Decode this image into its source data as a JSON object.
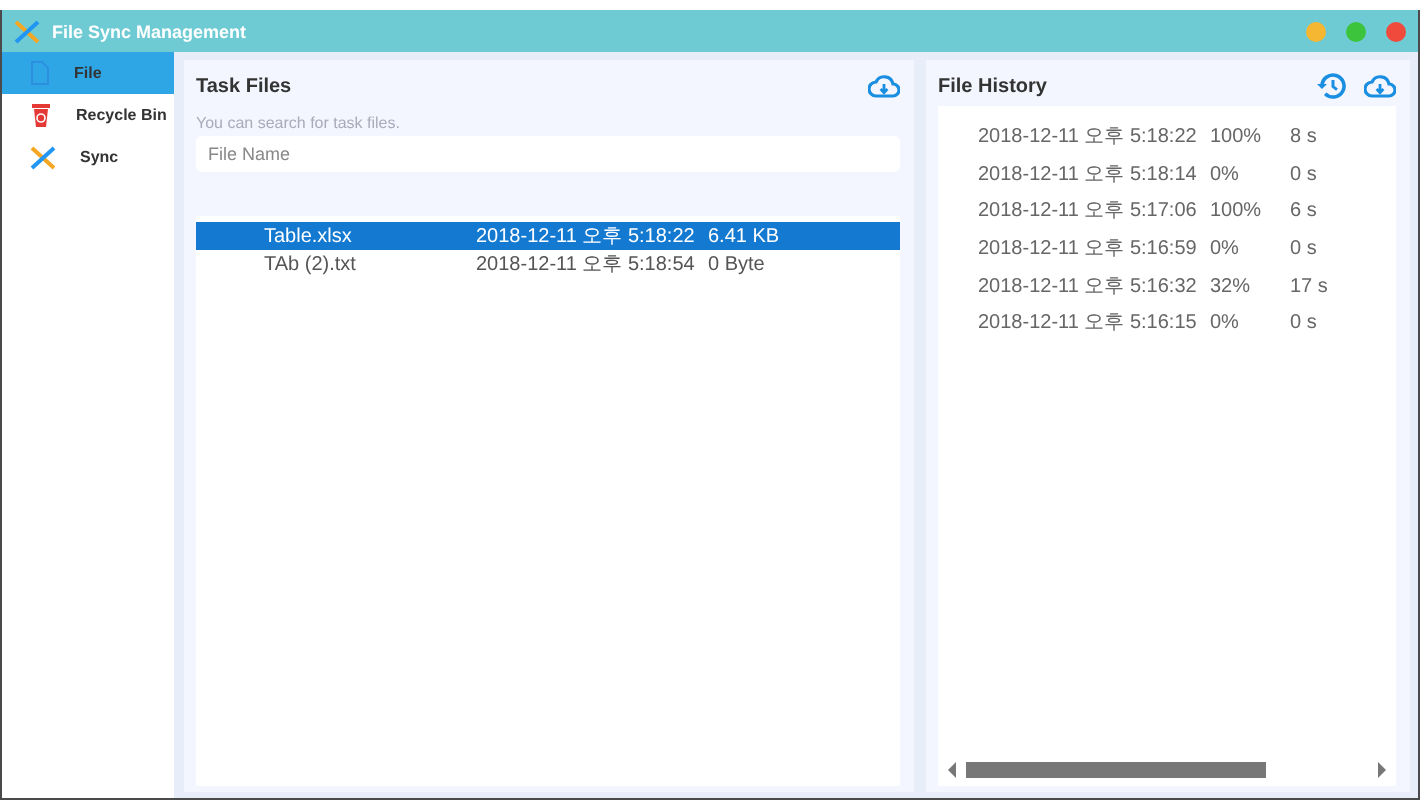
{
  "window": {
    "title": "File Sync Management"
  },
  "sidebar": {
    "items": [
      {
        "label": "File",
        "kind": "file",
        "selected": true
      },
      {
        "label": "Recycle Bin",
        "kind": "bin",
        "selected": false
      },
      {
        "label": "Sync",
        "kind": "sync",
        "selected": false
      }
    ]
  },
  "task_files": {
    "title": "Task Files",
    "hint": "You can search for task files.",
    "search": {
      "placeholder": "File Name"
    },
    "rows": [
      {
        "name": "Table.xlsx",
        "modified": "2018-12-11 오후 5:18:22",
        "size": "6.41 KB",
        "selected": true
      },
      {
        "name": "TAb (2).txt",
        "modified": "2018-12-11 오후 5:18:54",
        "size": "0 Byte",
        "selected": false
      }
    ]
  },
  "file_history": {
    "title": "File History",
    "rows": [
      {
        "time": "2018-12-11 오후 5:18:22",
        "progress": "100%",
        "duration": "8 s"
      },
      {
        "time": "2018-12-11 오후 5:18:14",
        "progress": "0%",
        "duration": "0 s"
      },
      {
        "time": "2018-12-11 오후 5:17:06",
        "progress": "100%",
        "duration": "6 s"
      },
      {
        "time": "2018-12-11 오후 5:16:59",
        "progress": "0%",
        "duration": "0 s"
      },
      {
        "time": "2018-12-11 오후 5:16:32",
        "progress": "32%",
        "duration": "17 s"
      },
      {
        "time": "2018-12-11 오후 5:16:15",
        "progress": "0%",
        "duration": "0 s"
      }
    ]
  }
}
